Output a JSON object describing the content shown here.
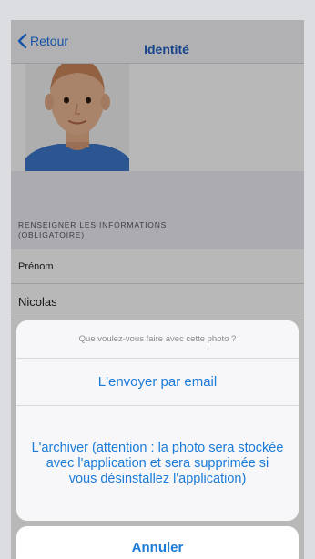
{
  "navbar": {
    "back_label": "Retour",
    "title": "Identité"
  },
  "section": {
    "header": "RENSEIGNER LES INFORMATIONS (OBLIGATOIRE)"
  },
  "form": {
    "first_name_label": "Prénom",
    "first_name_value": "Nicolas"
  },
  "action_sheet": {
    "title": "Que voulez-vous faire avec cette photo ?",
    "option_email": "L'envoyer par email",
    "option_archive": "L'archiver (attention : la photo sera stockée avec l'application et sera supprimée si vous désinstallez l'application)",
    "cancel_label": "Annuler"
  },
  "colors": {
    "accent": "#1b7bd8",
    "nav_title": "#1f5fbf"
  },
  "icons": {
    "back": "chevron-left-icon",
    "avatar": "avatar-icon"
  }
}
